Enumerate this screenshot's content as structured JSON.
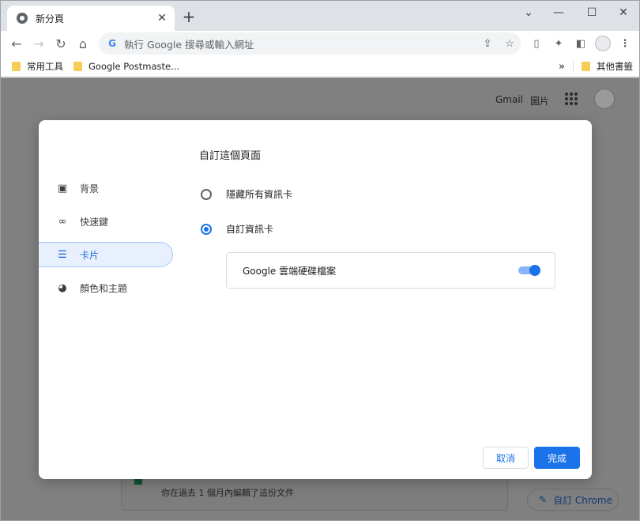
{
  "browser": {
    "tab_title": "新分頁",
    "tab_close": "✕",
    "new_tab": "+",
    "window_controls": {
      "dropdown": "⌄",
      "minimize": "—",
      "maximize": "☐",
      "close": "✕"
    },
    "omnibox_placeholder": "執行 Google 搜尋或輸入網址",
    "bookmarks": [
      {
        "label": "常用工具"
      },
      {
        "label": "Google Postmaste..."
      }
    ],
    "bookmarks_overflow": "»",
    "other_bookmarks": "其他書籤"
  },
  "page": {
    "header_links": [
      "Gmail",
      "圖片"
    ],
    "background_card_text": "你在過去 1 個月內編輯了這份文件",
    "customize_button": "自訂 Chrome"
  },
  "dialog": {
    "title": "自訂這個頁面",
    "nav": [
      {
        "label": "背景",
        "icon": "background-image-icon",
        "selected": false
      },
      {
        "label": "快速鍵",
        "icon": "link-icon",
        "selected": false
      },
      {
        "label": "卡片",
        "icon": "cards-icon",
        "selected": true
      },
      {
        "label": "顏色和主題",
        "icon": "palette-icon",
        "selected": false
      }
    ],
    "options": [
      {
        "label": "隱藏所有資訊卡",
        "checked": false
      },
      {
        "label": "自訂資訊卡",
        "checked": true
      }
    ],
    "card_toggle": {
      "label": "Google 雲端硬碟檔案",
      "on": true
    },
    "cancel_label": "取消",
    "done_label": "完成"
  },
  "colors": {
    "accent": "#1a73e8",
    "selected_bg": "#e8f0fe",
    "overlay": "#808080"
  }
}
